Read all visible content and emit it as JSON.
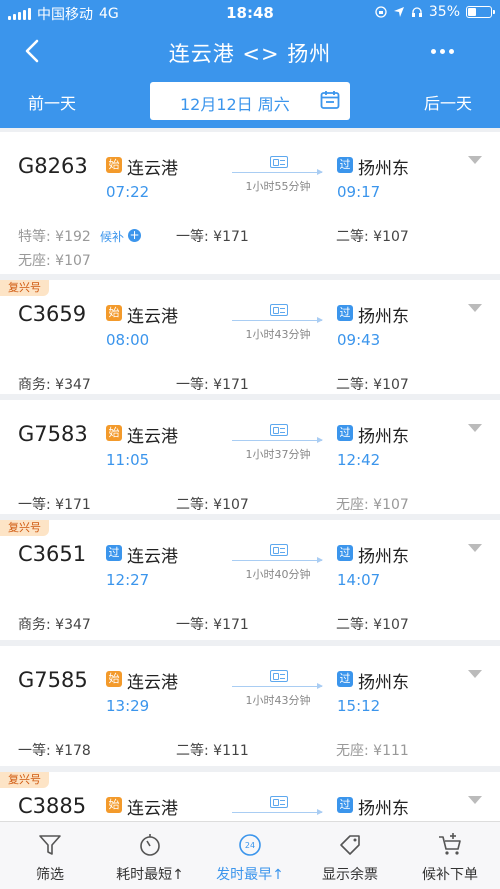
{
  "status": {
    "carrier": "中国移动",
    "network": "4G",
    "time": "18:48",
    "battery": "35%"
  },
  "nav": {
    "title": "连云港 <> 扬州"
  },
  "date_bar": {
    "prev": "前一天",
    "date": "12月12日 周六",
    "next": "后一天"
  },
  "colors": {
    "accent": "#3b95ec",
    "start_badge": "#f39a2b",
    "fuxing_tag": "#fde4c6"
  },
  "trains": [
    {
      "no": "G8263",
      "tag": "",
      "from_badge": "始",
      "from": "连云港",
      "dep": "07:22",
      "duration": "1小时55分钟",
      "to_badge": "过",
      "to": "扬州东",
      "arr": "09:17",
      "seats": [
        "特等: ¥192",
        "一等: ¥171",
        "二等: ¥107",
        "无座: ¥107"
      ],
      "waitlist": "候补"
    },
    {
      "no": "C3659",
      "tag": "复兴号",
      "from_badge": "始",
      "from": "连云港",
      "dep": "08:00",
      "duration": "1小时43分钟",
      "to_badge": "过",
      "to": "扬州东",
      "arr": "09:43",
      "seats": [
        "商务: ¥347",
        "一等: ¥171",
        "二等: ¥107"
      ]
    },
    {
      "no": "G7583",
      "tag": "",
      "from_badge": "始",
      "from": "连云港",
      "dep": "11:05",
      "duration": "1小时37分钟",
      "to_badge": "过",
      "to": "扬州东",
      "arr": "12:42",
      "seats": [
        "一等: ¥171",
        "二等: ¥107",
        "无座: ¥107"
      ]
    },
    {
      "no": "C3651",
      "tag": "复兴号",
      "from_badge": "过",
      "from": "连云港",
      "dep": "12:27",
      "duration": "1小时40分钟",
      "to_badge": "过",
      "to": "扬州东",
      "arr": "14:07",
      "seats": [
        "商务: ¥347",
        "一等: ¥171",
        "二等: ¥107"
      ]
    },
    {
      "no": "G7585",
      "tag": "",
      "from_badge": "始",
      "from": "连云港",
      "dep": "13:29",
      "duration": "1小时43分钟",
      "to_badge": "过",
      "to": "扬州东",
      "arr": "15:12",
      "seats": [
        "一等: ¥178",
        "二等: ¥111",
        "无座: ¥111"
      ]
    },
    {
      "no": "C3885",
      "tag": "复兴号",
      "from_badge": "始",
      "from": "连云港",
      "dep": "",
      "duration": "",
      "to_badge": "过",
      "to": "扬州东",
      "arr": "",
      "seats": []
    }
  ],
  "toolbar": [
    {
      "label": "筛选",
      "icon": "filter-icon"
    },
    {
      "label": "耗时最短↑",
      "icon": "stopwatch-icon"
    },
    {
      "label": "发时最早↑",
      "icon": "clock-24-icon",
      "active": true,
      "badge": "24"
    },
    {
      "label": "显示余票",
      "icon": "ticket-tag-icon"
    },
    {
      "label": "候补下单",
      "icon": "cart-plus-icon"
    }
  ]
}
